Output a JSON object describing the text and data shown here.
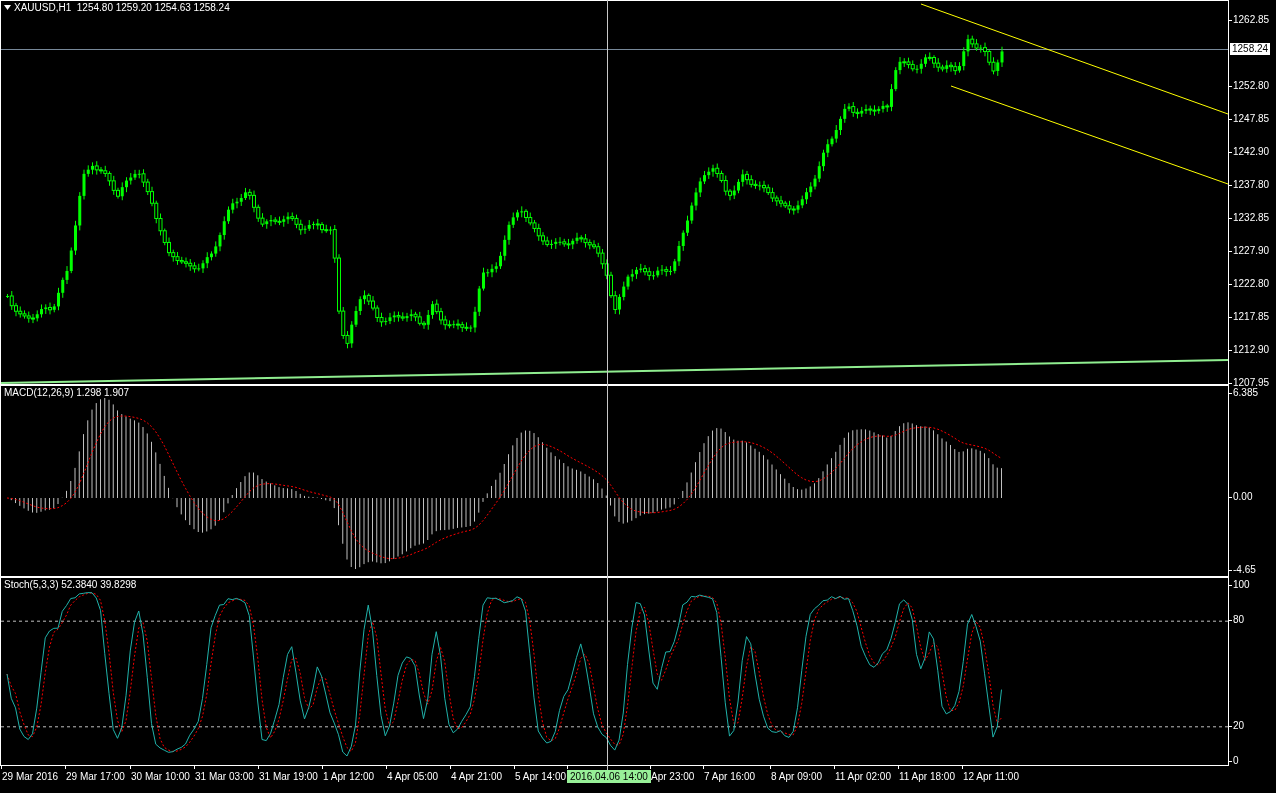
{
  "price_pane": {
    "header": "XAUUSD,H1  1254.80 1259.20 1254.63 1258.24",
    "current_price": "1258.24",
    "axis_labels": [
      "1262.85",
      "1252.80",
      "1247.85",
      "1242.90",
      "1237.80",
      "1232.85",
      "1227.90",
      "1222.80",
      "1217.85",
      "1212.90",
      "1207.95"
    ]
  },
  "macd_pane": {
    "header": "MACD(12,26,9) 1.298 1.907",
    "axis_labels": [
      "6.385",
      "0.00",
      "-4.65"
    ]
  },
  "stoch_pane": {
    "header": "Stoch(5,3,3) 52.3840 39.8298",
    "axis_labels": [
      "100",
      "80",
      "20",
      "0"
    ]
  },
  "time_axis": {
    "labels": [
      {
        "text": "29 Mar 2016",
        "selected": false
      },
      {
        "text": "29 Mar 17:00",
        "selected": false
      },
      {
        "text": "30 Mar 10:00",
        "selected": false
      },
      {
        "text": "31 Mar 03:00",
        "selected": false
      },
      {
        "text": "31 Mar 19:00",
        "selected": false
      },
      {
        "text": "1 Apr 12:00",
        "selected": false
      },
      {
        "text": "4 Apr 05:00",
        "selected": false
      },
      {
        "text": "4 Apr 21:00",
        "selected": false
      },
      {
        "text": "5 Apr 14:00",
        "selected": false
      },
      {
        "text": "2016.04.06 14:00",
        "selected": true
      },
      {
        "text": "Apr 23:00",
        "selected": false
      },
      {
        "text": "7 Apr 16:00",
        "selected": false
      },
      {
        "text": "8 Apr 09:00",
        "selected": false
      },
      {
        "text": "11 Apr 02:00",
        "selected": false
      },
      {
        "text": "11 Apr 18:00",
        "selected": false
      },
      {
        "text": "12 Apr 11:00",
        "selected": false
      }
    ]
  }
}
